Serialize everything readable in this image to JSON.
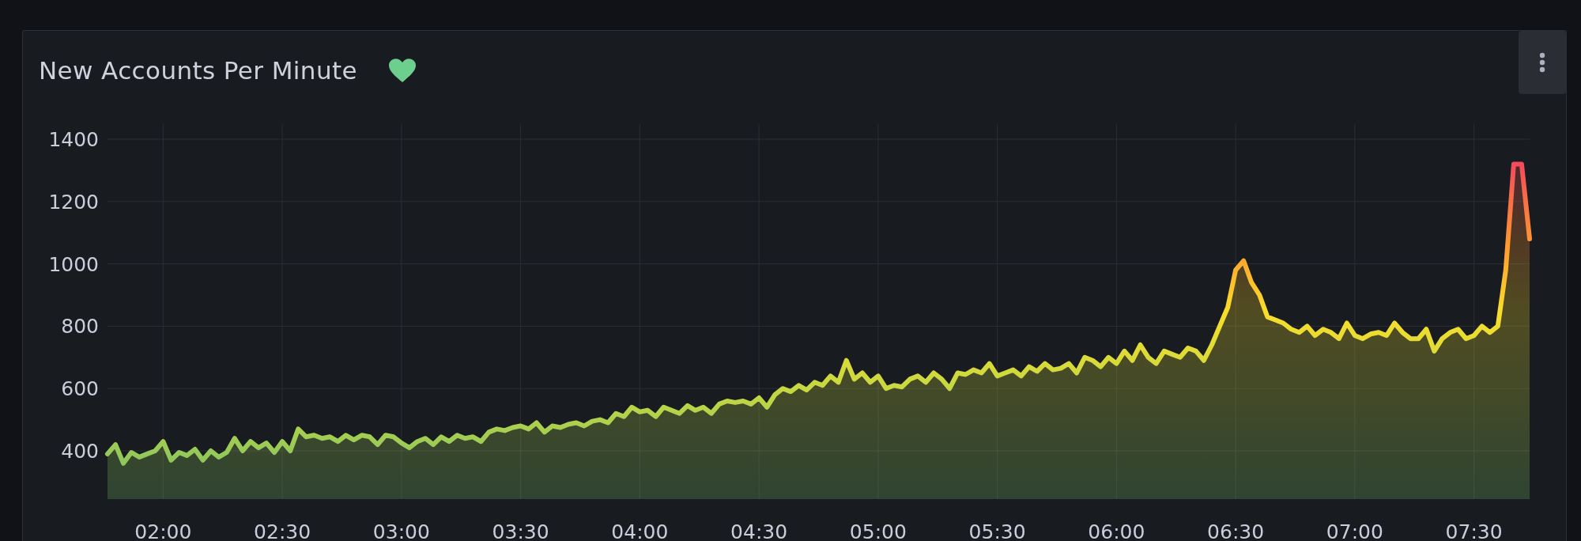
{
  "panel": {
    "title": "New Accounts Per Minute",
    "chart_data": {
      "type": "area",
      "x": [
        106,
        108,
        110,
        112,
        114,
        116,
        118,
        120,
        122,
        124,
        126,
        128,
        130,
        132,
        134,
        136,
        138,
        140,
        142,
        144,
        146,
        148,
        150,
        152,
        154,
        156,
        158,
        160,
        162,
        164,
        166,
        168,
        170,
        172,
        174,
        176,
        178,
        180,
        182,
        184,
        186,
        188,
        190,
        192,
        194,
        196,
        198,
        200,
        202,
        204,
        206,
        208,
        210,
        212,
        214,
        216,
        218,
        220,
        222,
        224,
        226,
        228,
        230,
        232,
        234,
        236,
        238,
        240,
        242,
        244,
        246,
        248,
        250,
        252,
        254,
        256,
        258,
        260,
        262,
        264,
        266,
        268,
        270,
        272,
        274,
        276,
        278,
        280,
        282,
        284,
        286,
        288,
        290,
        292,
        294,
        296,
        298,
        300,
        302,
        304,
        306,
        308,
        310,
        312,
        314,
        316,
        318,
        320,
        322,
        324,
        326,
        328,
        330,
        332,
        334,
        336,
        338,
        340,
        342,
        344,
        346,
        348,
        350,
        352,
        354,
        356,
        358,
        360,
        362,
        364,
        366,
        368,
        370,
        372,
        374,
        376,
        378,
        380,
        382,
        384,
        386,
        388,
        390,
        392,
        394,
        396,
        398,
        400,
        402,
        404,
        406,
        408,
        410,
        412,
        414,
        416,
        418,
        420,
        422,
        424,
        426,
        428,
        430,
        432,
        434,
        436,
        438,
        440,
        442,
        444,
        446,
        448,
        450,
        452,
        454,
        456,
        458,
        460,
        462,
        464
      ],
      "series": [
        {
          "color": "#73bf69",
          "values": [
            390,
            420,
            360,
            395,
            380,
            390,
            400,
            430,
            370,
            395,
            385,
            405,
            370,
            400,
            380,
            395,
            440,
            400,
            430,
            410,
            425,
            395,
            430,
            400,
            470,
            445,
            450,
            440,
            445,
            430,
            450,
            435,
            450,
            445,
            420,
            450,
            445,
            425,
            410,
            430,
            440,
            420,
            445,
            430,
            450,
            440,
            445,
            430,
            460,
            470,
            465,
            475,
            480,
            470,
            490,
            460,
            480,
            475,
            485,
            490,
            480,
            495,
            500,
            490,
            520,
            510,
            540,
            525,
            530,
            510,
            540,
            530,
            520,
            545,
            530,
            540,
            520,
            550,
            560,
            555,
            560,
            550,
            570,
            540,
            580,
            600,
            590,
            610,
            595,
            620,
            610,
            640,
            620,
            690,
            630,
            650,
            620,
            640,
            600,
            610,
            605,
            630,
            640,
            620,
            650,
            630,
            600,
            650,
            645,
            660,
            650,
            680,
            640,
            650,
            660,
            640,
            670,
            655,
            680,
            660,
            665,
            680,
            650,
            700,
            690,
            670,
            700,
            680,
            720,
            690,
            740,
            700,
            680,
            720,
            710,
            700,
            730,
            720,
            690,
            740,
            800,
            860,
            980,
            1010,
            940,
            900,
            830,
            820,
            810,
            790,
            780,
            800,
            770,
            790,
            780,
            760,
            810,
            770,
            760,
            775,
            780,
            770,
            810,
            780,
            760,
            760,
            790,
            720,
            760,
            780,
            790,
            760,
            770,
            800,
            780,
            800,
            980,
            1320,
            1320,
            1080
          ]
        }
      ],
      "xlim": [
        106,
        464
      ],
      "ylim": [
        245,
        1449
      ],
      "grid": true,
      "xticks": [
        {
          "value": 120,
          "label": "02:00"
        },
        {
          "value": 150,
          "label": "02:30"
        },
        {
          "value": 180,
          "label": "03:00"
        },
        {
          "value": 210,
          "label": "03:30"
        },
        {
          "value": 240,
          "label": "04:00"
        },
        {
          "value": 270,
          "label": "04:30"
        },
        {
          "value": 300,
          "label": "05:00"
        },
        {
          "value": 330,
          "label": "05:30"
        },
        {
          "value": 360,
          "label": "06:00"
        },
        {
          "value": 390,
          "label": "06:30"
        },
        {
          "value": 420,
          "label": "07:00"
        },
        {
          "value": 450,
          "label": "07:30"
        }
      ],
      "yticks": [
        400,
        600,
        800,
        1000,
        1200,
        1400
      ]
    }
  }
}
